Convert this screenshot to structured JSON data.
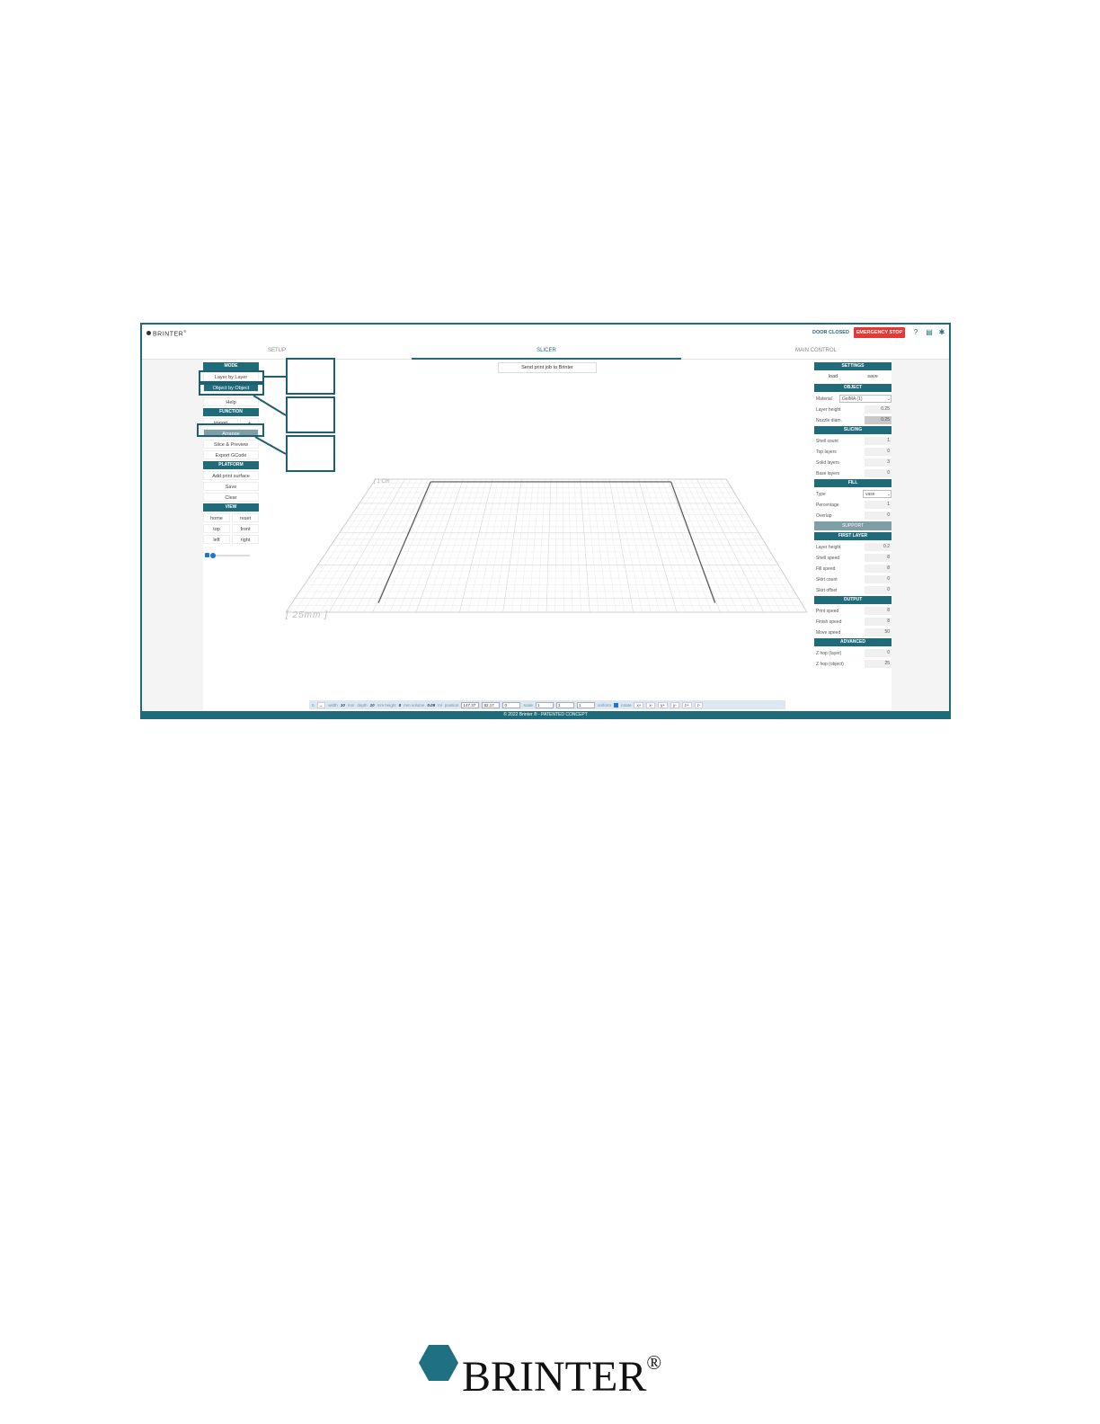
{
  "app": {
    "brand": "BRINTER",
    "brand_mark": "®"
  },
  "header": {
    "door_status": "DOOR CLOSED",
    "emergency_stop": "EMERGENCY STOP",
    "icons": [
      "help-icon",
      "document-icon",
      "gear-icon"
    ]
  },
  "tabs": [
    {
      "label": "SETUP",
      "active": false
    },
    {
      "label": "SLICER",
      "active": true
    },
    {
      "label": "MAIN CONTROL",
      "active": false
    }
  ],
  "left_panel": {
    "mode_header": "MODE",
    "mode_layer": "Layer by Layer",
    "mode_object": "Object by Object",
    "help": "Help",
    "function_header": "FUNCTION",
    "import": "import",
    "import_toggle": "+",
    "arrange": "Arrange",
    "slice_preview": "Slice & Preview",
    "export_gcode": "Export GCode",
    "platform_header": "PLATFORM",
    "add_print_surface": "Add print surface",
    "save": "Save",
    "clear": "Clear",
    "view_header": "VIEW",
    "view_home": "home",
    "view_reset": "reset",
    "view_top": "top",
    "view_front": "front",
    "view_left": "left",
    "view_right": "right"
  },
  "center": {
    "send_job": "Send print job to Brinter",
    "dim_y": "[ 1 Cm",
    "dim_x": "[ 25mm ]"
  },
  "right_panel": {
    "settings_header": "SETTINGS",
    "load": "load",
    "save": "save",
    "object_header": "OBJECT",
    "material_label": "Material",
    "material_value": "GelMA (1)",
    "layer_height_label": "Layer height",
    "layer_height": "0.25",
    "nozzle_label": "Nozzle diam.",
    "nozzle": "0.25",
    "slicing_header": "SLICING",
    "shell_count_label": "Shell count",
    "shell_count": "1",
    "top_layers_label": "Top layers",
    "top_layers": "0",
    "solid_layers_label": "Solid layers",
    "solid_layers": "3",
    "base_layers_label": "Base layers",
    "base_layers": "0",
    "fill_header": "FILL",
    "type_label": "Type",
    "type_value": "vase",
    "percentage_label": "Percentage",
    "percentage": "1",
    "overlap_label": "Overlap",
    "overlap": "0",
    "support_bar": "SUPPORT",
    "first_layer_header": "FIRST LAYER",
    "fl_layer_height_label": "Layer height",
    "fl_layer_height": "0.2",
    "fl_shell_speed_label": "Shell speed",
    "fl_shell_speed": "8",
    "fl_fill_speed_label": "Fill speed",
    "fl_fill_speed": "8",
    "skirt_count_label": "Skirt count",
    "skirt_count": "0",
    "skirt_offset_label": "Skirt offset",
    "skirt_offset": "0",
    "output_header": "OUTPUT",
    "print_speed_label": "Print speed",
    "print_speed": "8",
    "finish_speed_label": "Finish speed",
    "finish_speed": "8",
    "move_speed_label": "Move speed",
    "move_speed": "50",
    "advanced_header": "ADVANCED",
    "zhop_layer_label": "Z hop (layer)",
    "zhop_layer": "0",
    "zhop_object_label": "Z hop (object)",
    "zhop_object": "25"
  },
  "toolbar": {
    "sel": "0",
    "width_label": "width",
    "width": "10",
    "width_unit": "mm",
    "depth_label": "depth",
    "depth": "10",
    "height_label": "mm height",
    "height": "8",
    "volume_label": "mm volume",
    "volume": "0.09",
    "volume_unit": "ml",
    "position_label": "position",
    "pos_x": "147.37",
    "pos_y": "82.17",
    "pos_z": "0",
    "scale_label": "scale",
    "scale_x": "1",
    "scale_y": "1",
    "scale_z": "1",
    "uniform_label": "uniform",
    "rotate_label": "rotate",
    "rot_xp": "x+",
    "rot_xm": "x-",
    "rot_yp": "y+",
    "rot_ym": "y-",
    "rot_zp": "z+",
    "rot_zm": "z-"
  },
  "footer": {
    "text": "© 2022 Brinter ® - PATENTED CONCEPT"
  },
  "colors": {
    "accent": "#1f6b79",
    "estop": "#e53935",
    "toolbar": "#dbe7f3"
  }
}
